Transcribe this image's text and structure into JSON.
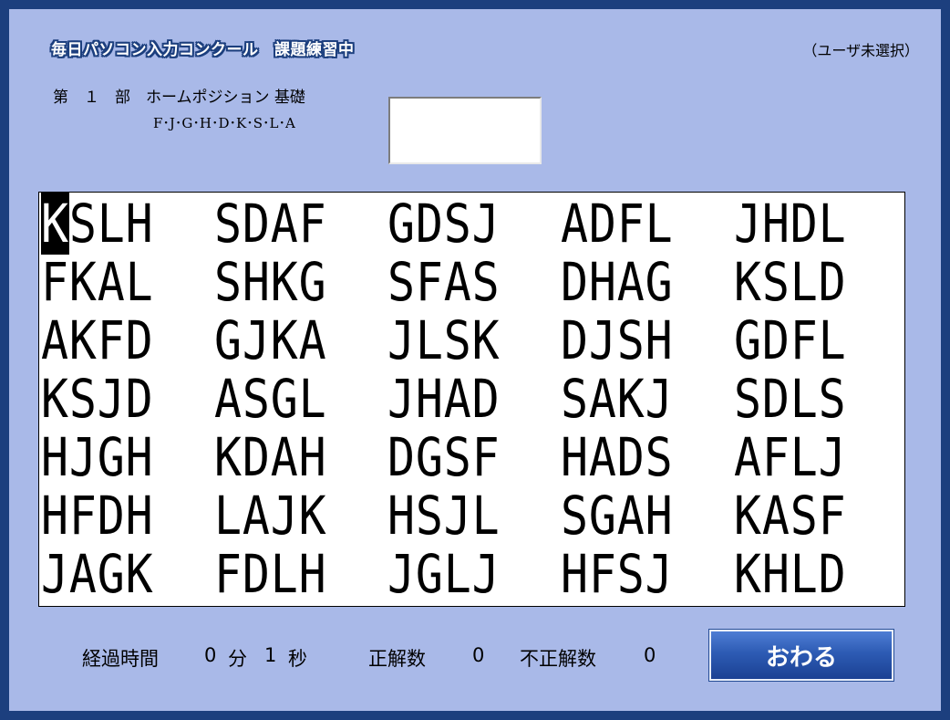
{
  "header": {
    "app_title": "毎日パソコン入力コンクール　課題練習中",
    "user_label": "（ユーザ未選択）"
  },
  "section": {
    "title": "第　１　部　ホームポジション 基礎",
    "keys": "F･J･G･H･D･K･S･L･A"
  },
  "practice": {
    "cursor_char": "K",
    "first_word_rest": "SLH",
    "rows": [
      [
        "KSLH",
        "SDAF",
        "GDSJ",
        "ADFL",
        "JHDL"
      ],
      [
        "FKAL",
        "SHKG",
        "SFAS",
        "DHAG",
        "KSLD"
      ],
      [
        "AKFD",
        "GJKA",
        "JLSK",
        "DJSH",
        "GDFL"
      ],
      [
        "KSJD",
        "ASGL",
        "JHAD",
        "SAKJ",
        "SDLS"
      ],
      [
        "HJGH",
        "KDAH",
        "DGSF",
        "HADS",
        "AFLJ"
      ],
      [
        "HFDH",
        "LAJK",
        "HSJL",
        "SGAH",
        "KASF"
      ],
      [
        "JAGK",
        "FDLH",
        "JGLJ",
        "HFSJ",
        "KHLD"
      ]
    ]
  },
  "status": {
    "elapsed_label": "経過時間",
    "minutes": "0",
    "minutes_unit": "分",
    "seconds": "1",
    "seconds_unit": "秒",
    "correct_label": "正解数",
    "correct_count": "0",
    "incorrect_label": "不正解数",
    "incorrect_count": "0"
  },
  "buttons": {
    "end_label": "おわる"
  },
  "colors": {
    "background": "#a9b9e8",
    "border": "#1c3f7e",
    "button": "#2d5bb4"
  }
}
